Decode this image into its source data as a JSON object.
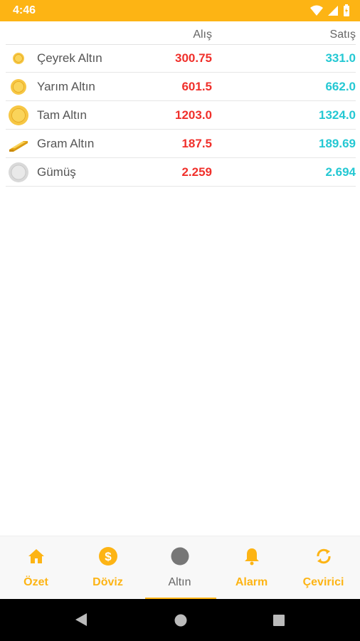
{
  "status_bar": {
    "time": "4:46"
  },
  "table": {
    "header": {
      "buy_label": "Alış",
      "sell_label": "Satış"
    },
    "rows": [
      {
        "name": "Çeyrek Altın",
        "buy": "300.75",
        "sell": "331.0",
        "icon": "small-gold-coin-icon"
      },
      {
        "name": "Yarım Altın",
        "buy": "601.5",
        "sell": "662.0",
        "icon": "medium-gold-coin-icon"
      },
      {
        "name": "Tam Altın",
        "buy": "1203.0",
        "sell": "1324.0",
        "icon": "large-gold-coin-icon"
      },
      {
        "name": "Gram Altın",
        "buy": "187.5",
        "sell": "189.69",
        "icon": "gold-bar-icon"
      },
      {
        "name": "Gümüş",
        "buy": "2.259",
        "sell": "2.694",
        "icon": "silver-coin-icon"
      }
    ]
  },
  "bottom_nav": {
    "items": [
      {
        "label": "Özet",
        "icon": "home-icon"
      },
      {
        "label": "Döviz",
        "icon": "dollar-circle-icon"
      },
      {
        "label": "Altın",
        "icon": "circle-icon",
        "active": true
      },
      {
        "label": "Alarm",
        "icon": "bell-icon"
      },
      {
        "label": "Çevirici",
        "icon": "refresh-icon"
      }
    ]
  },
  "colors": {
    "accent": "#FDB414",
    "buy": "#F0302B",
    "sell": "#24C8D3",
    "inactive_text": "#666666"
  }
}
